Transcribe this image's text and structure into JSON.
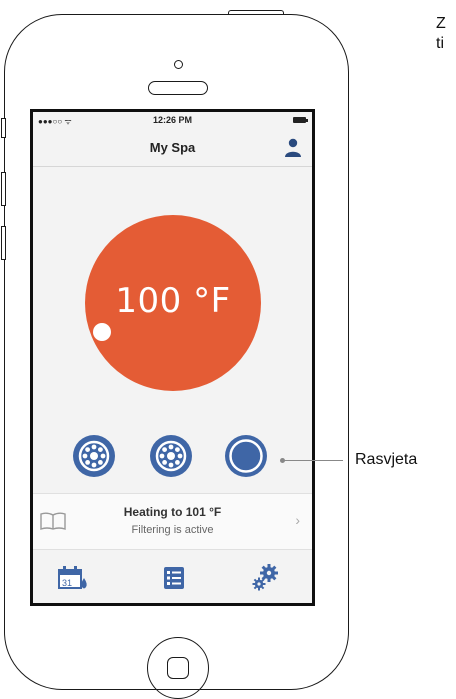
{
  "status_bar": {
    "time": "12:26 PM",
    "signal": "●●●○○ ᯤ"
  },
  "header": {
    "title": "My Spa"
  },
  "temperature": {
    "value": "100 °F"
  },
  "controls": [
    {
      "name": "jets-1",
      "icon": "jets-icon"
    },
    {
      "name": "jets-2",
      "icon": "jets-icon"
    },
    {
      "name": "light",
      "icon": "light-icon"
    }
  ],
  "info": {
    "heading": "Heating to 101 °F",
    "subtext": "Filtering is active"
  },
  "tabs": [
    {
      "name": "schedule",
      "icon": "calendar-icon",
      "day": "31"
    },
    {
      "name": "list",
      "icon": "list-icon"
    },
    {
      "name": "settings",
      "icon": "gears-icon"
    }
  ],
  "annotations": {
    "light_label": "Rasvjeta",
    "corner_text_line1": "Z",
    "corner_text_line2": "ti"
  },
  "colors": {
    "accent": "#e45c35",
    "control_blue": "#3f66a6",
    "tab_blue": "#3f66a6"
  }
}
